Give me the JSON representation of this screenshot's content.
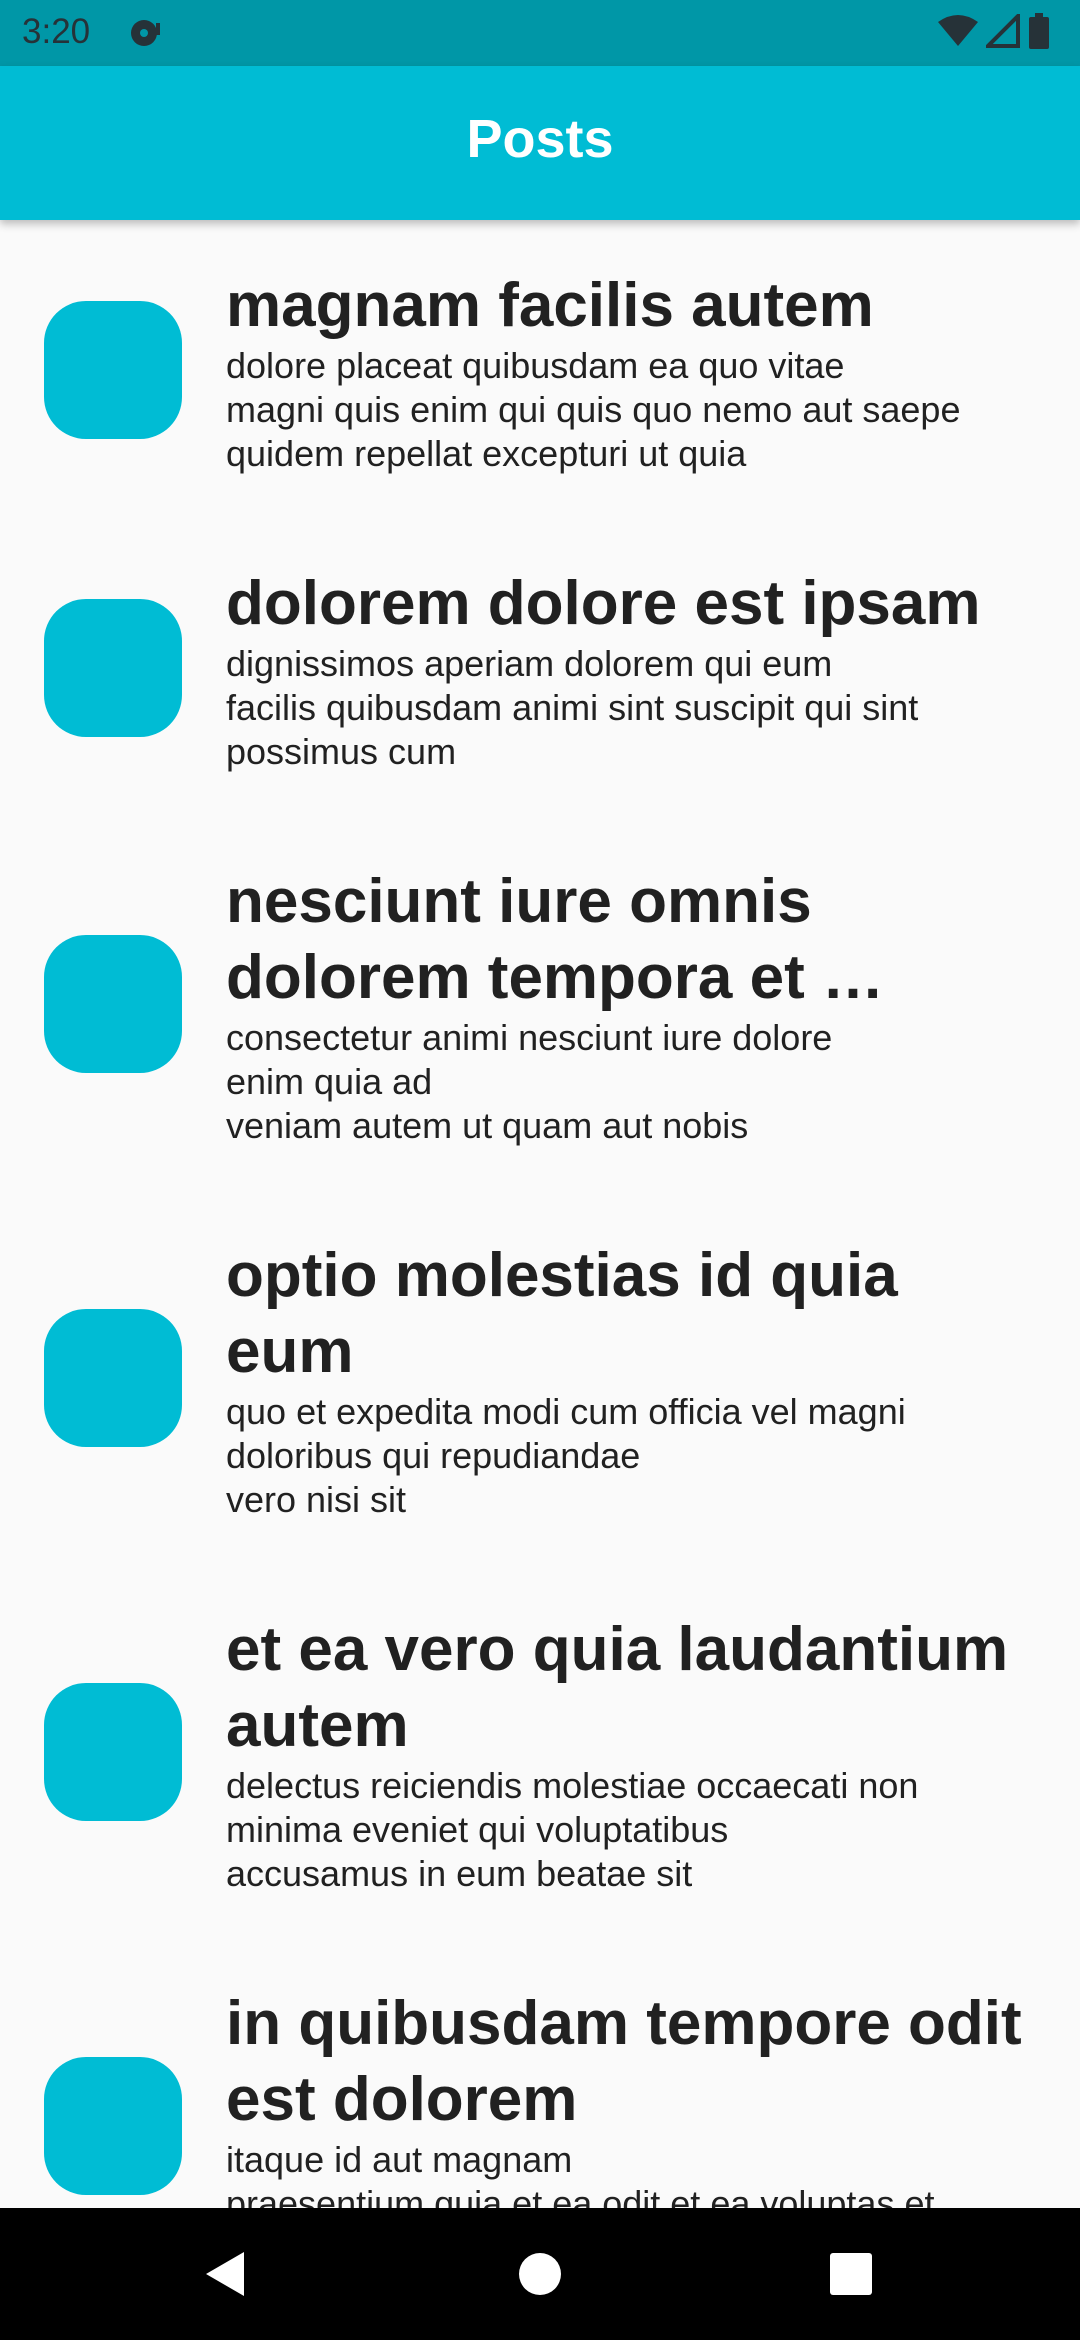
{
  "status_bar": {
    "time": "3:20",
    "notification_icon": "media-disc-icon",
    "icons": [
      "wifi-icon",
      "signal-icon",
      "battery-icon"
    ]
  },
  "app_bar": {
    "title": "Posts"
  },
  "colors": {
    "status_bar": "#0097a7",
    "app_bar": "#00bcd4",
    "avatar": "#00bcd4",
    "background": "#fafafa",
    "text": "#212121",
    "nav_bar": "#000000"
  },
  "posts": [
    {
      "title": "magnam facilis autem",
      "body": "dolore placeat quibusdam ea quo vitae\nmagni quis enim qui quis quo nemo aut saepe\nquidem repellat excepturi ut quia"
    },
    {
      "title": "dolorem dolore est ipsam",
      "body": "dignissimos aperiam dolorem qui eum\nfacilis quibusdam animi sint suscipit qui sint\npossimus cum"
    },
    {
      "title": "nesciunt iure omnis dolorem tempora et …",
      "body": "consectetur animi nesciunt iure dolore\nenim quia ad\nveniam autem ut quam aut nobis"
    },
    {
      "title": "optio molestias id quia eum",
      "body": "quo et expedita modi cum officia vel magni\ndoloribus qui repudiandae\nvero nisi sit"
    },
    {
      "title": "et ea vero quia laudantium autem",
      "body": "delectus reiciendis molestiae occaecati non\nminima eveniet qui voluptatibus\naccusamus in eum beatae sit"
    },
    {
      "title": "in quibusdam tempore odit est dolorem",
      "body": "itaque id aut magnam\npraesentium quia et ea odit et ea voluptas et"
    }
  ],
  "nav_bar": {
    "back": "back-icon",
    "home": "home-icon",
    "recents": "recents-icon"
  }
}
